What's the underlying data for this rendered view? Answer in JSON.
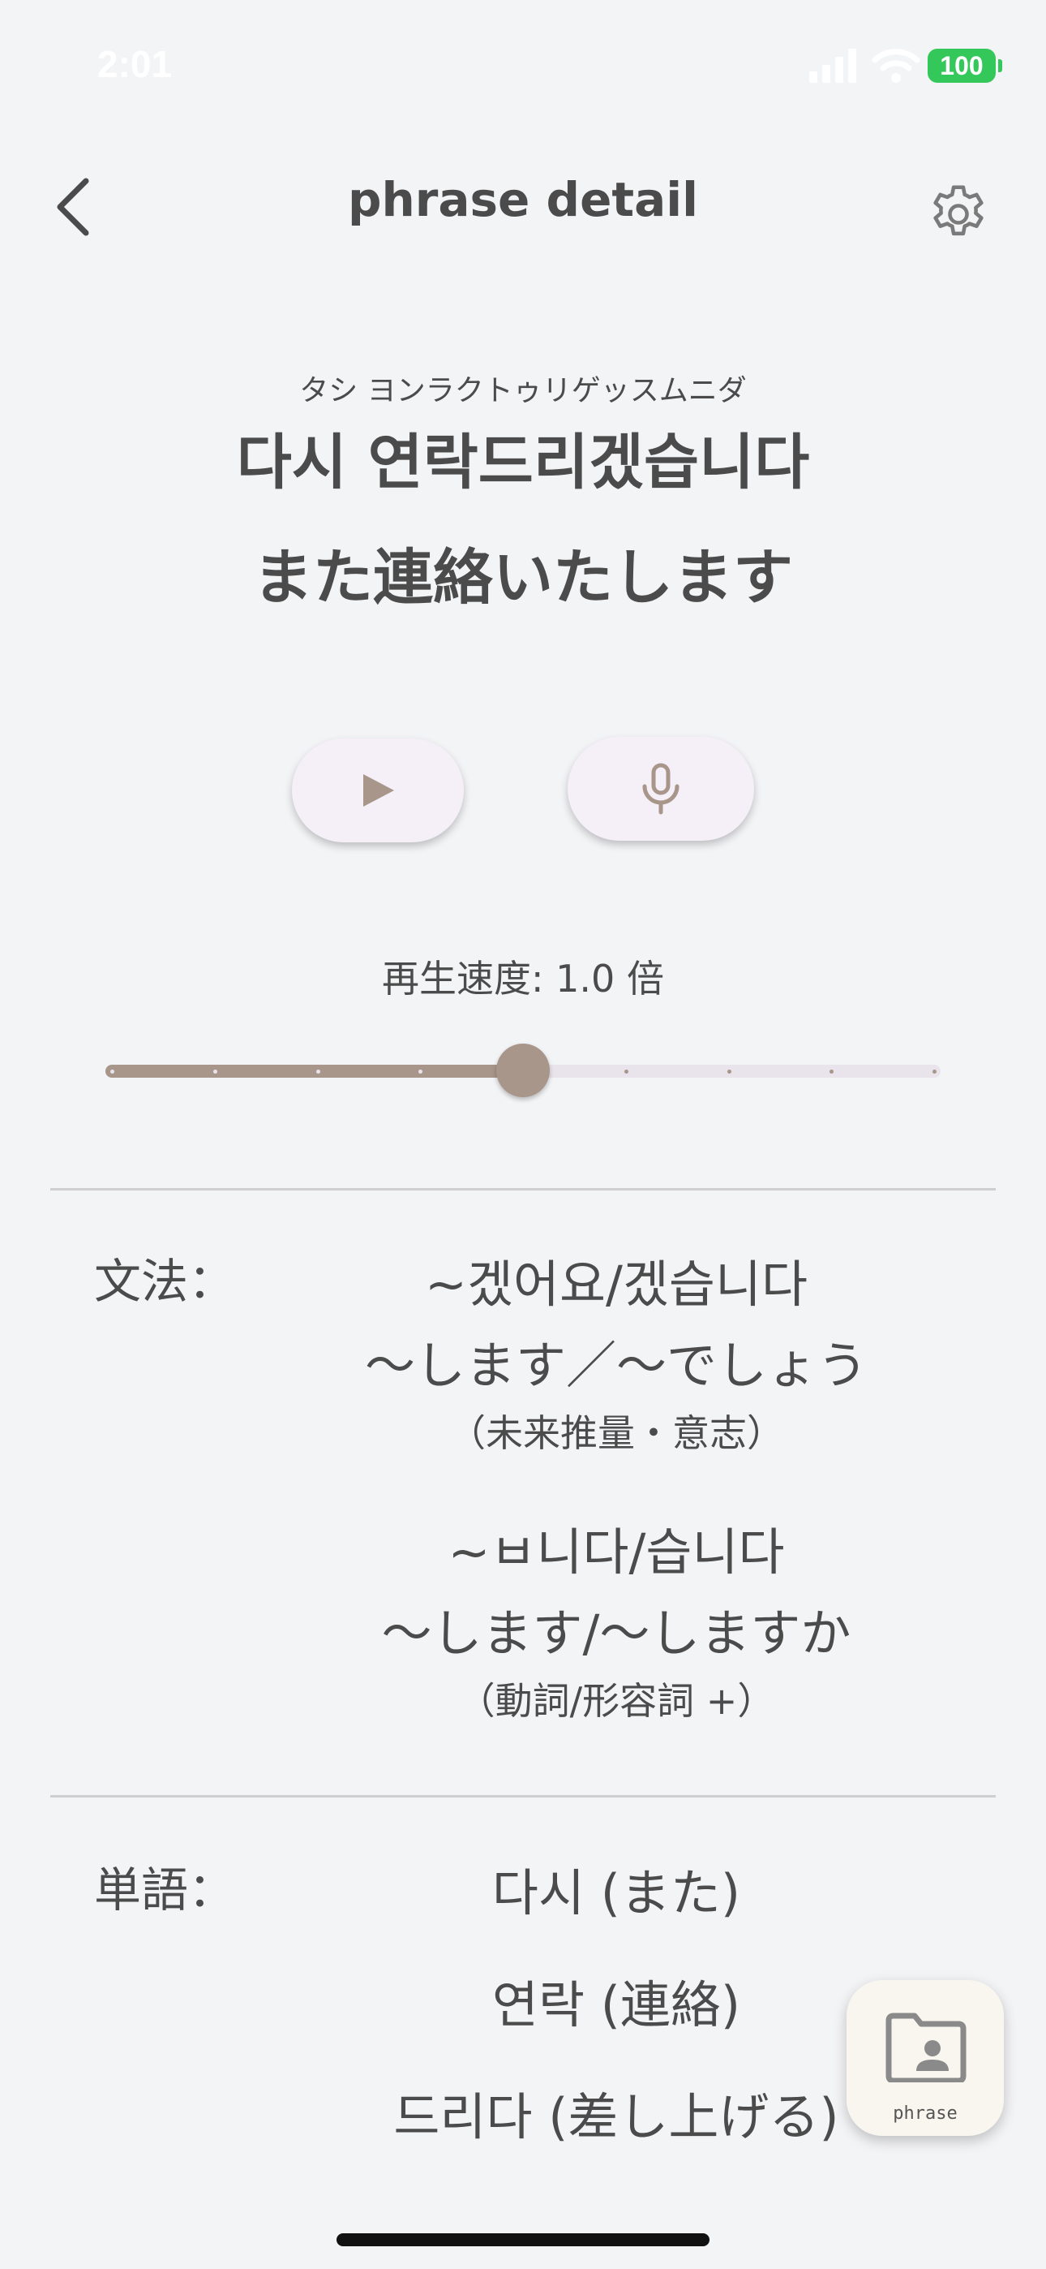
{
  "status_bar": {
    "time": "2:01",
    "battery": "100",
    "battery_color": "#34c759"
  },
  "header": {
    "title": "phrase detail",
    "back_icon": "chevron-left-icon",
    "settings_icon": "gear-icon"
  },
  "phrase": {
    "reading": "タシ ヨンラクトゥリゲッスムニダ",
    "korean": "다시 연락드리겠습니다",
    "japanese": "また連絡いたします"
  },
  "controls": {
    "play_icon": "play-icon",
    "mic_icon": "microphone-icon"
  },
  "speed": {
    "label": "再生速度: 1.0 倍",
    "slider_steps": 8,
    "slider_value_step": 4,
    "accent": "#a8968a"
  },
  "grammar": {
    "label": "文法：",
    "entries": [
      {
        "korean": "~겠어요/겠습니다",
        "japanese": "〜します／〜でしょう",
        "note": "（未来推量・意志）"
      },
      {
        "korean": "~ㅂ니다/습니다",
        "japanese": "〜します/〜しますか",
        "note": "（動詞/形容詞 +）"
      }
    ]
  },
  "vocabulary": {
    "label": "単語：",
    "items": [
      "다시 (また)",
      "연락 (連絡)",
      "드리다 (差し上げる)"
    ]
  },
  "fab": {
    "label": "phrase",
    "icon": "folder-person-icon"
  }
}
